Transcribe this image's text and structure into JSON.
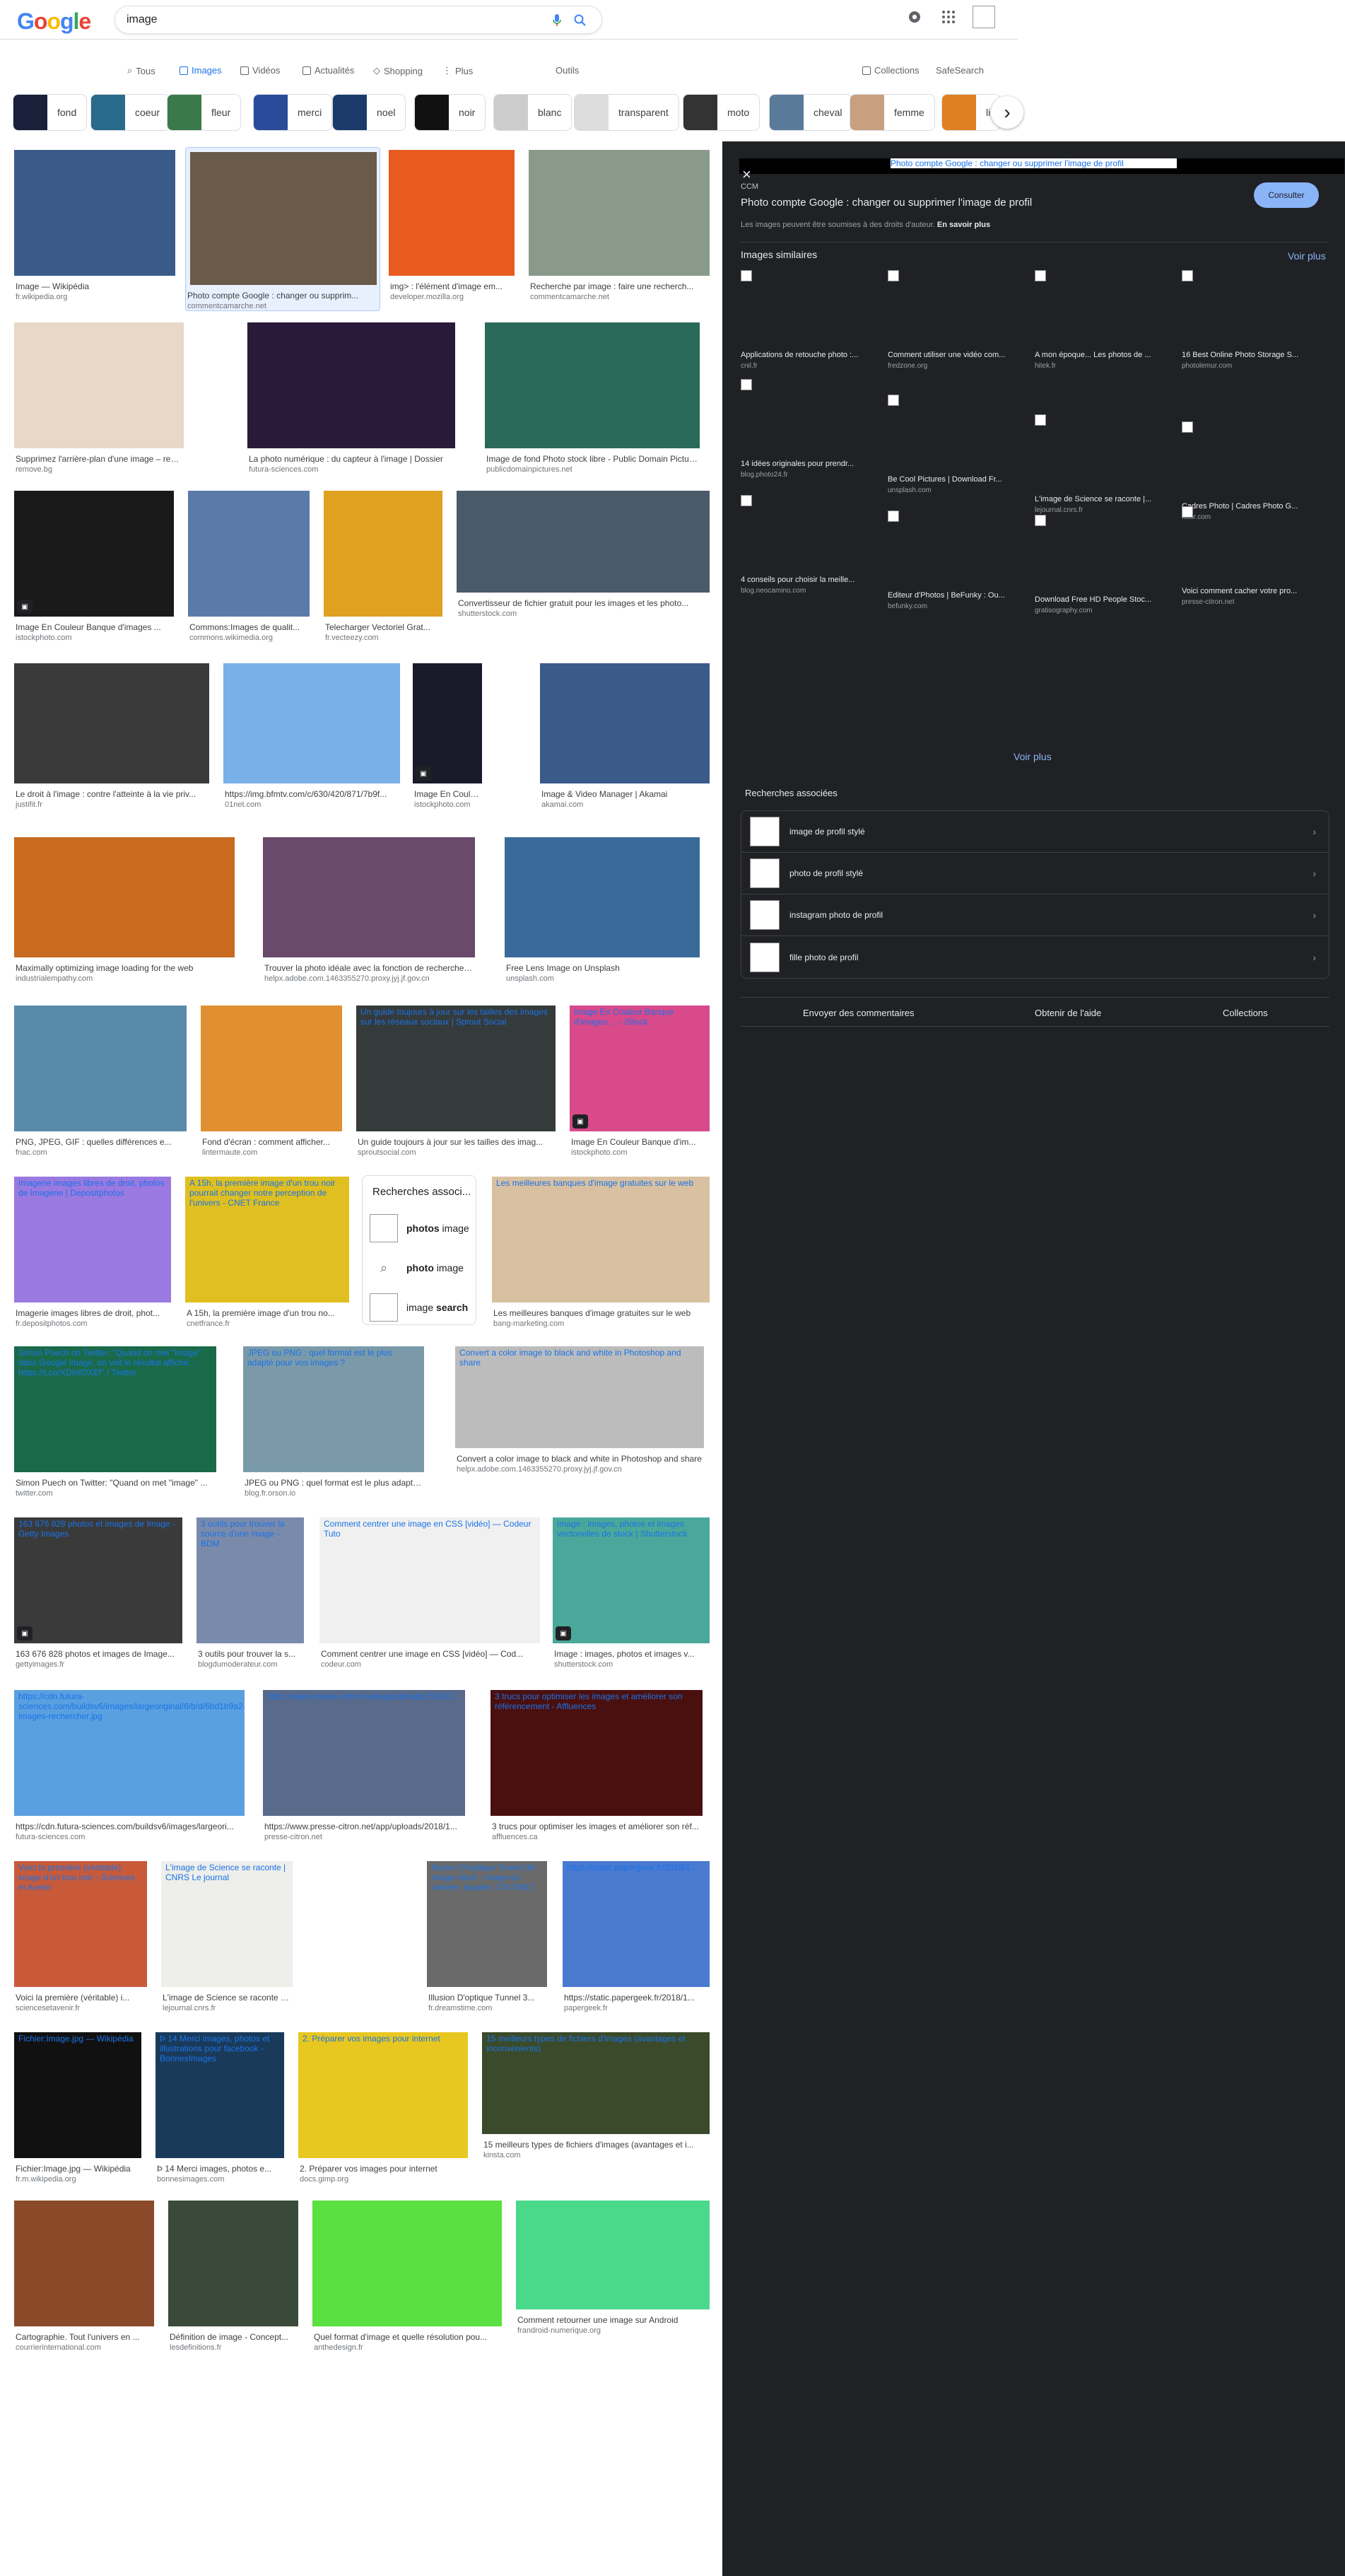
{
  "header": {
    "logo": "Google",
    "query": "image",
    "logo_colors": [
      "#4285f4",
      "#ea4335",
      "#fbbc05",
      "#4285f4",
      "#34a853",
      "#ea4335"
    ]
  },
  "tabs": {
    "items": [
      {
        "label": "Tous"
      },
      {
        "label": "Images"
      },
      {
        "label": "Vidéos"
      },
      {
        "label": "Actualités"
      },
      {
        "label": "Shopping"
      },
      {
        "label": "Plus"
      }
    ],
    "outils": "Outils",
    "collections": "Collections",
    "safesearch": "SafeSearch"
  },
  "chips": [
    {
      "label": "fond",
      "color": "#1a1f3a"
    },
    {
      "label": "coeur",
      "color": "#2a6a8a"
    },
    {
      "label": "fleur",
      "color": "#3a7a4a"
    },
    {
      "label": "merci",
      "color": "#2a4a9a"
    },
    {
      "label": "noel",
      "color": "#1a3a6a"
    },
    {
      "label": "noir",
      "color": "#111111"
    },
    {
      "label": "blanc",
      "color": "#cccccc"
    },
    {
      "label": "transparent",
      "color": "#dddddd"
    },
    {
      "label": "moto",
      "color": "#333333"
    },
    {
      "label": "cheval",
      "color": "#5a7a9a"
    },
    {
      "label": "femme",
      "color": "#c8a080"
    },
    {
      "label": "li",
      "color": "#e08020"
    }
  ],
  "results": [
    {
      "cap": "Image — Wikipédia",
      "src": "fr.wikipedia.org",
      "color": "#3a5a8a"
    },
    {
      "cap": "Photo compte Google : changer ou supprim...",
      "src": "commentcamarche.net",
      "color": "#6a5a4a"
    },
    {
      "cap": "img> : l'élément d'image em...",
      "src": "developer.mozilla.org",
      "color": "#e85a20"
    },
    {
      "cap": "Recherche par image : faire une recherch...",
      "src": "commentcamarche.net",
      "color": "#8a9a8a"
    },
    {
      "cap": "Supprimez l'arrière-plan d'une image – remove.bg",
      "src": "remove.bg",
      "color": "#e8d8c8"
    },
    {
      "cap": "La photo numérique : du capteur à l'image | Dossier",
      "src": "futura-sciences.com",
      "color": "#2a1a3a"
    },
    {
      "cap": "Image de fond Photo stock libre - Public Domain Pictures",
      "src": "publicdomainpictures.net",
      "color": "#2a6a5a"
    },
    {
      "cap": "Image En Couleur Banque d'images ...",
      "src": "istockphoto.com",
      "color": "#1a1a1a"
    },
    {
      "cap": "Commons:Images de qualit...",
      "src": "commons.wikimedia.org",
      "color": "#5a7aaa"
    },
    {
      "cap": "Telecharger Vectoriel Grat...",
      "src": "fr.vecteezy.com",
      "color": "#e0a020"
    },
    {
      "cap": "Convertisseur de fichier gratuit pour les images et les photo...",
      "src": "shutterstock.com",
      "color": "#4a5a6a"
    },
    {
      "cap": "Le droit à l'image : contre l'atteinte à la vie priv...",
      "src": "justifit.fr",
      "color": "#3a3a3a"
    },
    {
      "cap": "https://img.bfmtv.com/c/630/420/871/7b9f...",
      "src": "01net.com",
      "color": "#7ab0e8"
    },
    {
      "cap": "Image En Couleur Banq...",
      "src": "istockphoto.com",
      "color": "#1a1a2a"
    },
    {
      "cap": "Image & Video Manager | Akamai",
      "src": "akamai.com",
      "color": "#3a5a8a"
    },
    {
      "cap": "Maximally optimizing image loading for the web",
      "src": "industrialempathy.com",
      "color": "#c86a20"
    },
    {
      "cap": "Trouver la photo idéale avec la fonction de recherche i...",
      "src": "helpx.adobe.com.1463355270.proxy.jyj.jf.gov.cn",
      "color": "#6a4a6a"
    },
    {
      "cap": "Free Lens Image on Unsplash",
      "src": "unsplash.com",
      "color": "#3a6a9a"
    },
    {
      "cap": "PNG, JPEG, GIF : quelles différences e...",
      "src": "fnac.com",
      "color": "#5a8aaa"
    },
    {
      "cap": "Fond d'écran : comment afficher...",
      "src": "lintermaute.com",
      "color": "#e09030"
    },
    {
      "cap": "Un guide toujours à jour sur les tailles des imag...",
      "src": "sproutsocial.com",
      "color": "#353a3a",
      "alt": "Un guide toujours à jour sur les tailles des images sur les réseaux sociaux | Sprout Social"
    },
    {
      "cap": "Image En Couleur Banque d'im...",
      "src": "istockphoto.com",
      "color": "#d84a8a",
      "alt": "Image En Couleur Banque d'images ... - iStock"
    },
    {
      "cap": "Imagerie images libres de droit, phot...",
      "src": "fr.depositphotos.com",
      "color": "#9a7ae0",
      "alt": "Imagerie images libres de droit, photos de Imagerie | Depositphotos"
    },
    {
      "cap": "A 15h, la première image d'un trou no...",
      "src": "cnetfrance.fr",
      "color": "#e0c020",
      "alt": "A 15h, la première image d'un trou noir pourrait changer notre perception de l'univers - CNET France"
    },
    {
      "cap": "Les meilleures banques d'image gratuites sur le web",
      "src": "bang-marketing.com",
      "color": "#d8c0a0",
      "alt": "Les meilleures banques d'image gratuites sur le web"
    },
    {
      "cap": "Simon Puech on Twitter: \"Quand on met \"image\" ...",
      "src": "twitter.com",
      "color": "#1a6a4a",
      "alt": "Simon Puech on Twitter: \"Quand on met \"image\" dans Google Image, on voit le résultat affiché... https://t.co/XDInfOXEf\" / Twitter"
    },
    {
      "cap": "JPEG ou PNG : quel format est le plus adapté ...",
      "src": "blog.fr.orson.io",
      "color": "#7a9aaa",
      "alt": "JPEG ou PNG : quel format est le plus adapté pour vos images ?"
    },
    {
      "cap": "Convert a color image to black and white in Photoshop and share",
      "src": "helpx.adobe.com.1463355270.proxy.jyj.jf.gov.cn",
      "color": "#bcbcbc",
      "alt": "Convert a color image to black and white in Photoshop and share"
    },
    {
      "cap": "163 676 828 photos et images de Image...",
      "src": "gettyimages.fr",
      "color": "#3a3a3a",
      "alt": "163 676 828 photos et images de Image - Getty Images"
    },
    {
      "cap": "3 outils pour trouver la s...",
      "src": "blogdumoderateur.com",
      "color": "#7a8aaa",
      "alt": "3 outils pour trouver la source d'une image - BDM"
    },
    {
      "cap": "Comment centrer une image en CSS [vidéo] — Cod...",
      "src": "codeur.com",
      "color": "#f0f0f0",
      "alt": "Comment centrer une image en CSS [vidéo] — Codeur Tuto"
    },
    {
      "cap": "Image : images, photos et images v...",
      "src": "shutterstock.com",
      "color": "#4aa89a",
      "alt": "Image : images, photos et images vectorielles de stock | Shutterstock"
    },
    {
      "cap": "https://cdn.futura-sciences.com/buildsv6/images/largeori...",
      "src": "futura-sciences.com",
      "color": "#5aa0e0",
      "alt": "https://cdn.futura-sciences.com/buildsv6/images/largeoriginal/6/b/d/6bd1b9a2-images-rechercher.jpg"
    },
    {
      "cap": "https://www.presse-citron.net/app/uploads/2018/1...",
      "src": "presse-citron.net",
      "color": "#5a6a8a",
      "alt": "https://www.presse-citron.net/app/uploads/2018/1..."
    },
    {
      "cap": "3 trucs pour optimiser les images et améliorer son réf...",
      "src": "affluences.ca",
      "color": "#4a1010",
      "alt": "3 trucs pour optimiser les images et améliorer son référencement - Affluences"
    },
    {
      "cap": "Voici la première (véritable) i...",
      "src": "sciencesetavenir.fr",
      "color": "#c85a3a",
      "alt": "Voici la première (véritable) image d'un trou noir - Sciences et Avenir"
    },
    {
      "cap": "L'image de Science se raconte | CNRS Le journal",
      "src": "lejournal.cnrs.fr",
      "color": "#eeeeea",
      "alt": "L'image de Science se raconte | CNRS Le journal"
    },
    {
      "cap": "Illusion D'optique Tunnel 3...",
      "src": "fr.dreamstime.com",
      "color": "#6a6a6a",
      "alt": "Illusion D'optique Tunnel 3d Image stock - Image du lumière, bandes: 37474917"
    },
    {
      "cap": "https://static.papergeek.fr/2018/1...",
      "src": "papergeek.fr",
      "color": "#4a7ad0",
      "alt": "https://static.papergeek.fr/2018/1..."
    },
    {
      "cap": "Fichier:Image.jpg — Wikipédia",
      "src": "fr.m.wikipedia.org",
      "color": "#111111",
      "alt": "Fichier:Image.jpg — Wikipédia"
    },
    {
      "cap": "Þ 14 Merci images, photos e...",
      "src": "bonnesimages.com",
      "color": "#1a3a5a",
      "alt": "Þ 14 Merci images, photos et illustrations pour facebook - BonnesImages"
    },
    {
      "cap": "2. Préparer vos images pour internet",
      "src": "docs.gimp.org",
      "color": "#e8c820",
      "alt": "2. Préparer vos images pour internet"
    },
    {
      "cap": "15 meilleurs types de fichiers d'images (avantages et i...",
      "src": "kinsta.com",
      "color": "#3a4a2a",
      "alt": "15 meilleurs types de fichiers d'images (avantages et inconvénients)"
    },
    {
      "cap": "Cartographie. Tout l'univers en ...",
      "src": "courrierinternational.com",
      "color": "#8a4a2a"
    },
    {
      "cap": "Définition de image - Concept...",
      "src": "lesdefinitions.fr",
      "color": "#3a4a3a"
    },
    {
      "cap": "Quel format d'image et quelle résolution pou...",
      "src": "anthedesign.fr",
      "color": "#5ae040"
    },
    {
      "cap": "Comment retourner une image sur Android",
      "src": "frandroid-numerique.org",
      "color": "#4ad88a"
    }
  ],
  "related_box": {
    "title": "Recherches associ...",
    "items": [
      {
        "bold": "photos",
        "rest": " image"
      },
      {
        "bold": "photo",
        "rest": " image"
      },
      {
        "bold": "",
        "rest": "image ",
        "bold2": "search"
      }
    ]
  },
  "panel": {
    "close": "×",
    "preview_alt": "Photo compte Google : changer ou supprimer l'image de profil",
    "site": "CCM",
    "title": "Photo compte Google : changer ou supprimer l'image de profil",
    "copyright": "Les images peuvent être soumises à des droits d'auteur.",
    "learn_more": "En savoir plus",
    "visit": "Consulter",
    "similar_title": "Images similaires",
    "see_more": "Voir plus",
    "similar": [
      {
        "cap": "Applications de retouche photo :...",
        "src": "cnil.fr"
      },
      {
        "cap": "14 idées originales pour prendr...",
        "src": "blog.photo24.fr"
      },
      {
        "cap": "4 conseils pour choisir la meille...",
        "src": "blog.neocamino.com"
      },
      {
        "cap": "Comment utiliser une vidéo com...",
        "src": "fredzone.org"
      },
      {
        "cap": "Be Cool Pictures | Download Fr...",
        "src": "unsplash.com"
      },
      {
        "cap": "Editeur d'Photos | BeFunky : Ou...",
        "src": "befunky.com"
      },
      {
        "cap": "A mon époque... Les photos de ...",
        "src": "hitek.fr"
      },
      {
        "cap": "L'image de Science se raconte |...",
        "src": "lejournal.cnrs.fr"
      },
      {
        "cap": "Download Free HD People Stoc...",
        "src": "gratisography.com"
      },
      {
        "cap": "16 Best Online Photo Storage S...",
        "src": "photolemur.com"
      },
      {
        "cap": "Cadres Photo | Cadres Photo G...",
        "src": "fotor.com"
      },
      {
        "cap": "Voici comment cacher votre pro...",
        "src": "presse-citron.net"
      }
    ],
    "see_more_bottom": "Voir plus",
    "related_title": "Recherches associées",
    "related": [
      {
        "label": "image de profil stylé"
      },
      {
        "label": "photo de profil stylé"
      },
      {
        "label": "instagram photo de profil"
      },
      {
        "label": "fille photo de profil"
      }
    ],
    "footer": {
      "feedback": "Envoyer des commentaires",
      "help": "Obtenir de l'aide",
      "collections": "Collections"
    }
  }
}
